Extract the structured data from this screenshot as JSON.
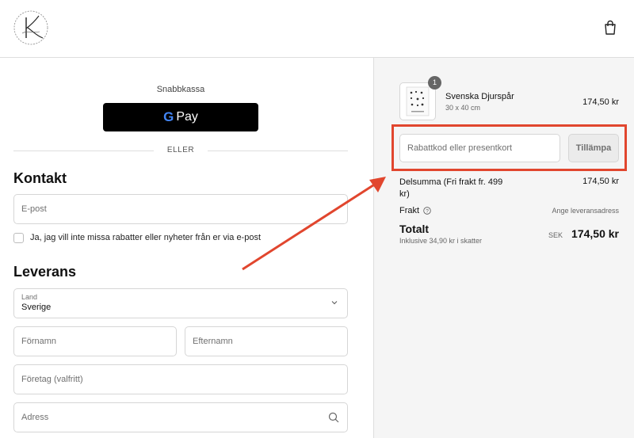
{
  "header": {
    "logo_icon": "store-logo-emblem",
    "cart_icon": "shopping-bag-icon"
  },
  "express": {
    "label": "Snabbkassa",
    "gpay_label": "Pay",
    "gpay_icon": "google-g-logo"
  },
  "divider": {
    "text": "ELLER"
  },
  "contact": {
    "heading": "Kontakt",
    "email_placeholder": "E-post",
    "optout_label": "Ja, jag vill inte missa rabatter eller nyheter från er via e-post"
  },
  "delivery": {
    "heading": "Leverans",
    "country_label": "Land",
    "country_value": "Sverige",
    "first_name_placeholder": "Förnamn",
    "last_name_placeholder": "Efternamn",
    "company_placeholder": "Företag (valfritt)",
    "address_placeholder": "Adress"
  },
  "cart": {
    "quantity": "1",
    "product_name": "Svenska Djurspår",
    "product_variant": "30 x 40 cm",
    "product_price": "174,50 kr"
  },
  "discount": {
    "placeholder": "Rabattkod eller presentkort",
    "apply_label": "Tillämpa",
    "highlight_color": "#e1462e"
  },
  "summary": {
    "subtotal_label": "Delsumma (Fri frakt fr. 499 kr)",
    "subtotal_value": "174,50 kr",
    "shipping_label": "Frakt",
    "shipping_value": "Ange leveransadress",
    "total_label": "Totalt",
    "tax_note": "Inklusive 34,90 kr i skatter",
    "currency": "SEK",
    "total_value": "174,50 kr"
  },
  "annotation": {
    "arrow_color": "#e1462e"
  }
}
